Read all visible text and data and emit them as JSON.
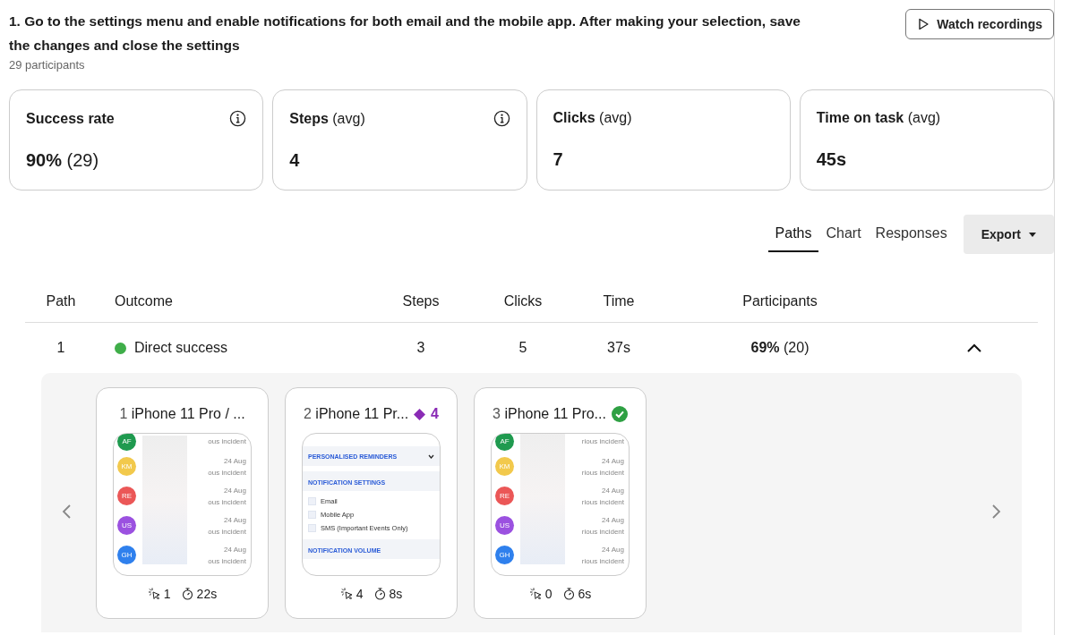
{
  "task": {
    "title": "1. Go to the settings menu and enable notifications for both email and the mobile app. After making your selection, save the changes and close the settings",
    "participants": "29 participants"
  },
  "watch_button": "Watch recordings",
  "metrics": [
    {
      "label": "Success rate",
      "value": "90%",
      "value_extra": "(29)",
      "info": true
    },
    {
      "label": "Steps",
      "qualifier": "(avg)",
      "value": "4",
      "info": true
    },
    {
      "label": "Clicks",
      "qualifier": "(avg)",
      "value": "7",
      "info": false
    },
    {
      "label": "Time on task",
      "qualifier": "(avg)",
      "value": "45s",
      "info": false
    }
  ],
  "view_tabs": [
    {
      "label": "Paths",
      "selected": true
    },
    {
      "label": "Chart",
      "selected": false
    },
    {
      "label": "Responses",
      "selected": false
    }
  ],
  "export_button": "Export",
  "table": {
    "columns": [
      "Path",
      "Outcome",
      "Steps",
      "Clicks",
      "Time",
      "Participants"
    ],
    "rows": [
      {
        "path": "1",
        "outcome": "Direct success",
        "color": "#3fae49",
        "steps": "3",
        "clicks": "5",
        "time": "37s",
        "participants_pct": "69%",
        "participants_count": "(20)",
        "expanded": true
      }
    ]
  },
  "screens": [
    {
      "number": "1",
      "title": "iPhone 11 Pro / ...",
      "clicks": "1",
      "time": "22s",
      "thumb": {
        "kind": "list",
        "rows": [
          {
            "initials": "AF",
            "color": "#1f9a4f",
            "preview": "ous incident"
          },
          {
            "initials": "KM",
            "color": "#f2c94c",
            "date": "24 Aug",
            "preview": "ous incident"
          },
          {
            "initials": "RE",
            "color": "#eb5757",
            "date": "24 Aug",
            "preview": "ous incident"
          },
          {
            "initials": "US",
            "color": "#9b51e0",
            "date": "24 Aug",
            "preview": "ous incident"
          },
          {
            "initials": "GH",
            "color": "#2f80ed",
            "date": "24 Aug",
            "preview": "ous incident"
          }
        ]
      }
    },
    {
      "number": "2",
      "title": "iPhone 11 Pr...",
      "badge": {
        "kind": "diamond",
        "text": "4"
      },
      "clicks": "4",
      "time": "8s",
      "thumb": {
        "kind": "settings",
        "sections": [
          {
            "kind": "header",
            "text": "PERSONALISED REMINDERS"
          },
          {
            "kind": "section",
            "text": "NOTIFICATION SETTINGS"
          },
          {
            "kind": "option",
            "text": "Email",
            "checked": false
          },
          {
            "kind": "option",
            "text": "Mobile App",
            "checked": false
          },
          {
            "kind": "option",
            "text": "SMS (Important Events Only)",
            "checked": false
          },
          {
            "kind": "section",
            "text": "NOTIFICATION VOLUME"
          }
        ]
      }
    },
    {
      "number": "3",
      "title": "iPhone 11 Pro...",
      "badge": {
        "kind": "check"
      },
      "clicks": "0",
      "time": "6s",
      "thumb": {
        "kind": "list",
        "rows": [
          {
            "initials": "AF",
            "color": "#1f9a4f",
            "preview": "rious incident"
          },
          {
            "initials": "KM",
            "color": "#f2c94c",
            "date": "24 Aug",
            "preview": "rious incident"
          },
          {
            "initials": "RE",
            "color": "#eb5757",
            "date": "24 Aug",
            "preview": "rious incident"
          },
          {
            "initials": "US",
            "color": "#9b51e0",
            "date": "24 Aug",
            "preview": "rious incident"
          },
          {
            "initials": "GH",
            "color": "#2f80ed",
            "date": "24 Aug",
            "preview": "rious incident"
          }
        ]
      }
    }
  ]
}
